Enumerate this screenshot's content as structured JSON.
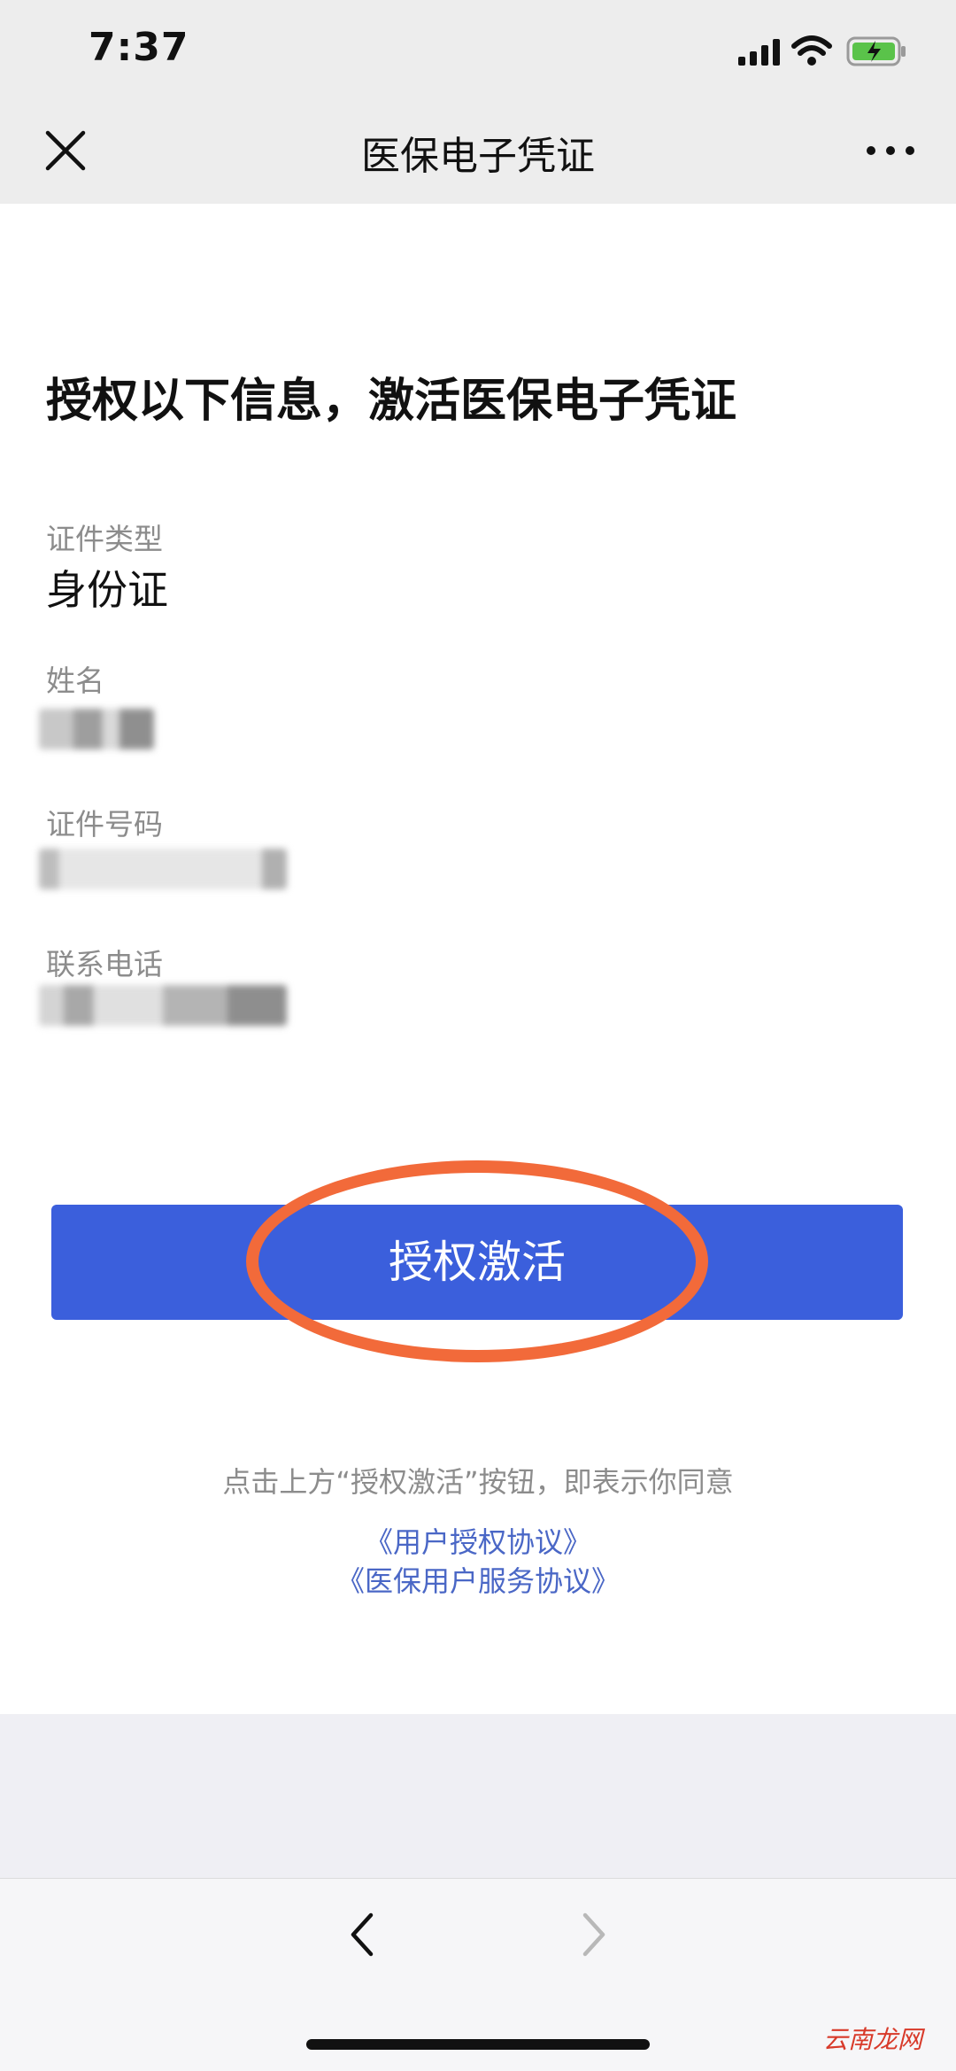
{
  "status_bar": {
    "time": "7:37"
  },
  "nav": {
    "title": "医保电子凭证"
  },
  "main": {
    "heading": "授权以下信息，激活医保电子凭证",
    "fields": [
      {
        "label": "证件类型",
        "value": "身份证"
      },
      {
        "label": "姓名"
      },
      {
        "label": "证件号码"
      },
      {
        "label": "联系电话"
      }
    ],
    "auth_button": "授权激活",
    "notice": "点击上方“授权激活”按钮，即表示你同意",
    "links": [
      "《用户授权协议》",
      "《医保用户服务协议》"
    ]
  },
  "colors": {
    "accent": "#3b5fdc",
    "highlight": "#f26a3a",
    "link": "#4a67c6"
  },
  "watermark": "云南龙网"
}
